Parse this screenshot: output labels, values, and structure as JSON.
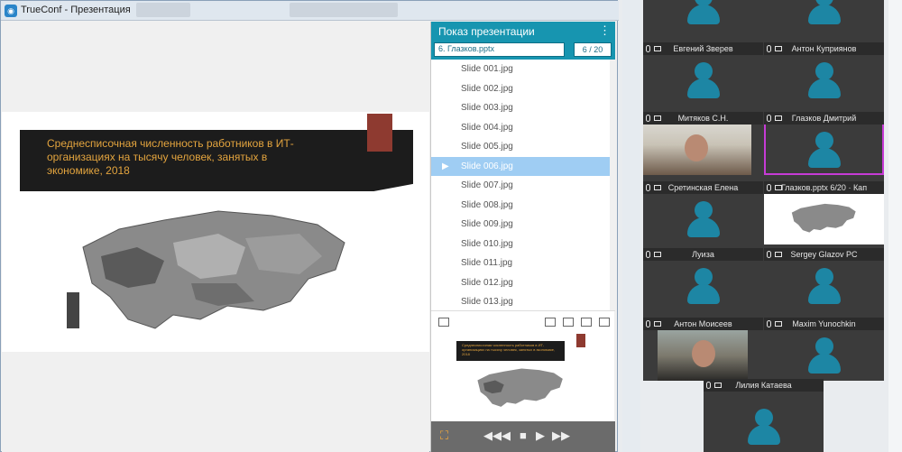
{
  "window": {
    "title": "TrueConf - Презентация",
    "app_icon": "trueconf-icon"
  },
  "slide": {
    "title": "Среднесписочная численность работников в ИТ-организациях на тысячу человек, занятых в экономике, 2018",
    "colors": {
      "band": "#1c1c1c",
      "accent": "#8e3a30",
      "title": "#e3a43e"
    }
  },
  "panel": {
    "title": "Показ презентации",
    "file": "6. Глазков.pptx",
    "page": "6 / 20",
    "active_index": 5,
    "slides": [
      "Slide 001.jpg",
      "Slide 002.jpg",
      "Slide 003.jpg",
      "Slide 004.jpg",
      "Slide 005.jpg",
      "Slide 006.jpg",
      "Slide 007.jpg",
      "Slide 008.jpg",
      "Slide 009.jpg",
      "Slide 010.jpg",
      "Slide 011.jpg",
      "Slide 012.jpg",
      "Slide 013.jpg"
    ],
    "accent_color": "#1795b0",
    "active_color": "#9fcdf3"
  },
  "participants": [
    {
      "name": ""
    },
    {
      "name": ""
    },
    {
      "name": "Евгений Зверев"
    },
    {
      "name": "Антон Куприянов"
    },
    {
      "name": "Митяков С.Н."
    },
    {
      "name": "Глазков Дмитрий"
    },
    {
      "name": "Сретинская Елена"
    },
    {
      "name": "Глазков.pptx 6/20 · Кап"
    },
    {
      "name": "Луиза"
    },
    {
      "name": "Sergey Glazov PC"
    },
    {
      "name": "Антон Моисеев"
    },
    {
      "name": "Maxim Yunochkin"
    },
    {
      "name": "Лилия Катаева"
    }
  ]
}
